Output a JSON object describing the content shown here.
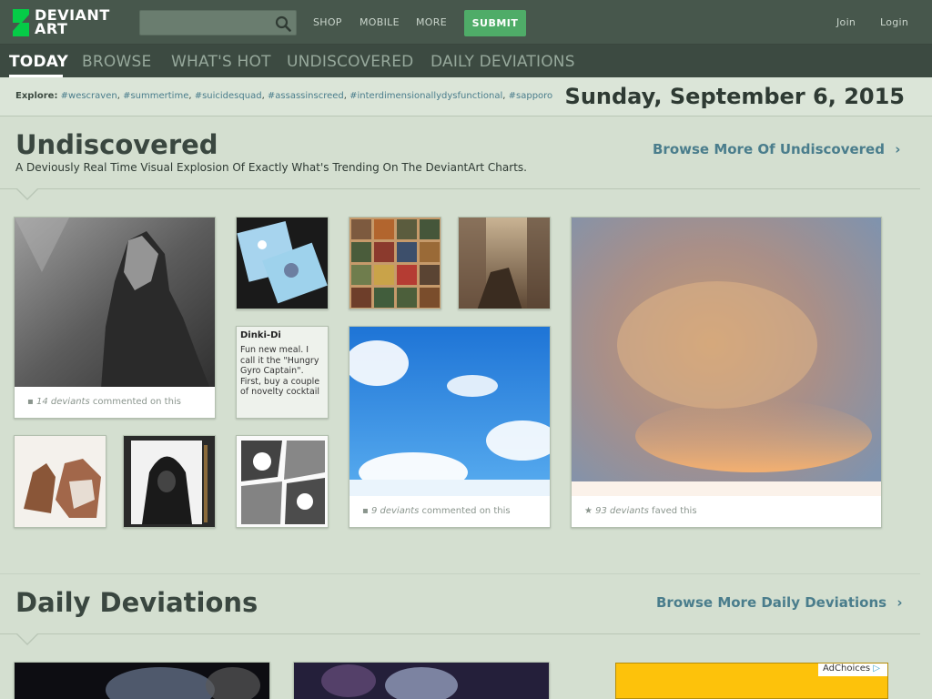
{
  "header": {
    "logo_line1": "DEVIANT",
    "logo_line2": "ART",
    "search_placeholder": "",
    "nav": [
      "SHOP",
      "MOBILE",
      "MORE"
    ],
    "submit_label": "SUBMIT",
    "join_label": "Join",
    "login_label": "Login",
    "colors": {
      "topbar": "#47574c",
      "submit": "#4fac68",
      "accent": "#4a7d8c"
    }
  },
  "tabs": [
    {
      "label": "TODAY",
      "active": true
    },
    {
      "label": "BROWSE",
      "active": false
    },
    {
      "label": "WHAT'S HOT",
      "active": false
    },
    {
      "label": "UNDISCOVERED",
      "active": false
    },
    {
      "label": "DAILY DEVIATIONS",
      "active": false
    }
  ],
  "explore": {
    "label": "Explore:",
    "tags": [
      "#wescraven",
      "#summertime",
      "#suicidesquad",
      "#assassinscreed",
      "#interdimensionallydysfunctional",
      "#sapporo"
    ]
  },
  "date": "Sunday, September 6, 2015",
  "undiscovered": {
    "title": "Undiscovered",
    "subtitle": "A Deviously Real Time Visual Explosion Of Exactly What's Trending On The DeviantArt Charts.",
    "browse_more": "Browse More Of Undiscovered",
    "cards": {
      "dark_figure": {
        "count": "14 deviants",
        "action": "commented on this"
      },
      "sky": {
        "count": "9 deviants",
        "action": "commented on this"
      },
      "cloud": {
        "count": "93 deviants",
        "action": "faved this"
      },
      "literature": {
        "title": "Dinki-Di",
        "body": "Fun new meal. I call it the \"Hungry Gyro Captain\". First, buy a couple of novelty cocktail"
      }
    }
  },
  "daily": {
    "title": "Daily Deviations",
    "browse_more": "Browse More Daily Deviations"
  },
  "ad": {
    "choices_label": "AdChoices"
  }
}
